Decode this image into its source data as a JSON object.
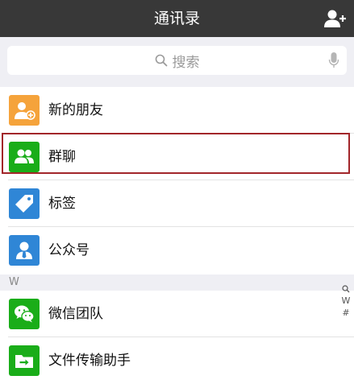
{
  "header": {
    "title": "通讯录",
    "add_contact_icon": "add-contact-icon"
  },
  "search": {
    "placeholder": "搜索",
    "icon": "search-icon",
    "voice_icon": "microphone-icon"
  },
  "contacts_top": [
    {
      "label": "新的朋友",
      "icon": "new-friends-icon",
      "color": "#f5a33b"
    },
    {
      "label": "群聊",
      "icon": "group-chat-icon",
      "color": "#1aad19"
    },
    {
      "label": "标签",
      "icon": "tag-icon",
      "color": "#2f86d6"
    },
    {
      "label": "公众号",
      "icon": "official-account-icon",
      "color": "#2f86d6"
    }
  ],
  "section": {
    "letter": "W"
  },
  "contacts_w": [
    {
      "label": "微信团队",
      "icon": "wechat-team-icon",
      "color": "#1aad19"
    },
    {
      "label": "文件传输助手",
      "icon": "file-transfer-icon",
      "color": "#1aad19"
    }
  ],
  "index_bar": [
    "Q",
    "W",
    "#"
  ],
  "colors": {
    "header_bg": "#383838",
    "highlight_border": "#a2262a"
  }
}
